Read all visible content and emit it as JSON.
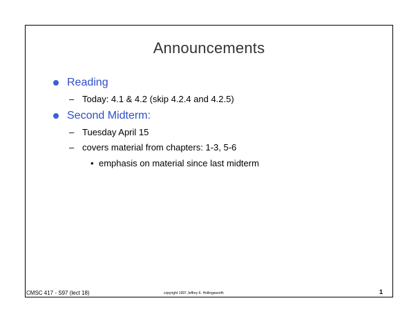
{
  "slide": {
    "title": "Announcements",
    "items": [
      {
        "heading": "Reading",
        "subitems": [
          {
            "marker": "–",
            "text": "Today: 4.1 & 4.2 (skip 4.2.4 and 4.2.5)"
          }
        ]
      },
      {
        "heading": "Second Midterm:",
        "subitems": [
          {
            "marker": "–",
            "text": "Tuesday April 15"
          },
          {
            "marker": "–",
            "text": "covers material from chapters: 1-3, 5-6"
          }
        ],
        "subsubitems": [
          {
            "marker": "•",
            "text": "emphasis on material since last midterm"
          }
        ]
      }
    ],
    "footer": {
      "left": "CMSC 417 - S97  (lect 18)",
      "center": "copyright 1997  Jeffrey K. Hollingsworth",
      "page": "1"
    }
  }
}
